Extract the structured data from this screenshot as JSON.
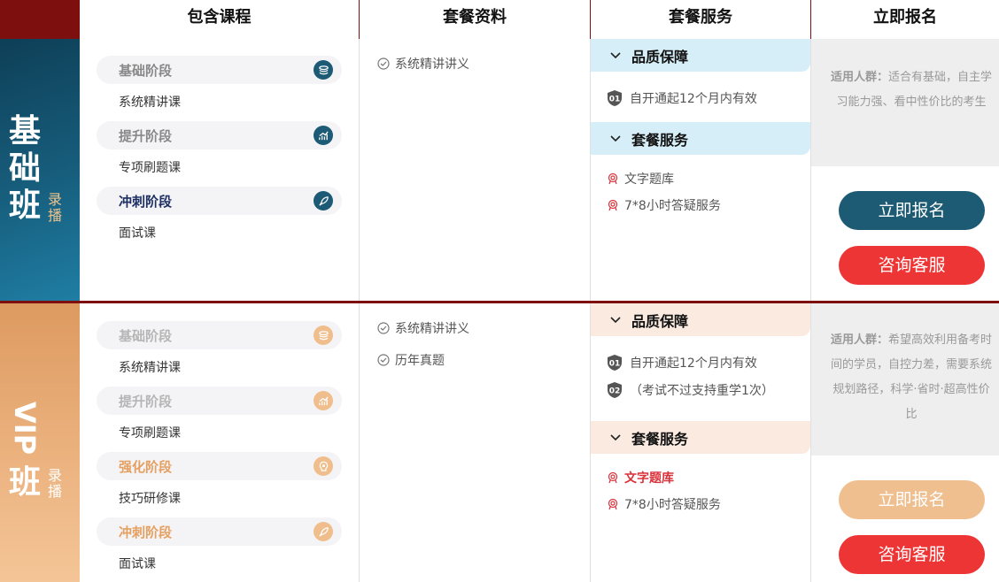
{
  "header": {
    "columns": [
      "包含课程",
      "套餐资料",
      "套餐服务",
      "立即报名"
    ]
  },
  "plans": [
    {
      "id": "basic",
      "title": "基础班",
      "mode": "录播",
      "stages": [
        {
          "label": "基础阶段",
          "icon": "stack-icon",
          "course": "系统精讲课"
        },
        {
          "label": "提升阶段",
          "icon": "growth-chart-icon",
          "course": "专项刷题课"
        },
        {
          "label": "冲刺阶段",
          "icon": "rocket-icon",
          "course": "面试课"
        }
      ],
      "materials": [
        "系统精讲讲义"
      ],
      "quality_title": "品质保障",
      "quality_items": [
        {
          "num": "01",
          "text": "自开通起12个月内有效"
        }
      ],
      "service_title": "套餐服务",
      "service_items": [
        "文字题库",
        "7*8小时答疑服务"
      ],
      "audience_label": "适用人群：",
      "audience_text": "适合有基础，自主学习能力强、看中性价比的考生",
      "enroll_label": "立即报名",
      "consult_label": "咨询客服"
    },
    {
      "id": "vip",
      "title_top": "VIP",
      "title_bottom": "班",
      "mode": "录播",
      "stages": [
        {
          "label": "基础阶段",
          "icon": "stack-icon",
          "course": "系统精讲课"
        },
        {
          "label": "提升阶段",
          "icon": "growth-chart-icon",
          "course": "专项刷题课"
        },
        {
          "label": "强化阶段",
          "icon": "lightbulb-head-icon",
          "course": "技巧研修课"
        },
        {
          "label": "冲刺阶段",
          "icon": "rocket-icon",
          "course": "面试课"
        }
      ],
      "materials": [
        "系统精讲讲义",
        "历年真题"
      ],
      "quality_title": "品质保障",
      "quality_items": [
        {
          "num": "01",
          "text": "自开通起12个月内有效"
        },
        {
          "num": "02",
          "text": "（考试不过支持重学1次）"
        }
      ],
      "service_title": "套餐服务",
      "service_items": [
        "文字题库",
        "7*8小时答疑服务"
      ],
      "audience_label": "适用人群：",
      "audience_text": "希望高效利用备考时间的学员，自控力差，需要系统规划路径，科学·省时·超高性价比",
      "enroll_label": "立即报名",
      "consult_label": "咨询客服"
    }
  ],
  "colors": {
    "header_corner": "#7d0f0f",
    "basic_accent": "#1d5a74",
    "vip_accent": "#efbf8f",
    "consult_red": "#ee3535"
  }
}
